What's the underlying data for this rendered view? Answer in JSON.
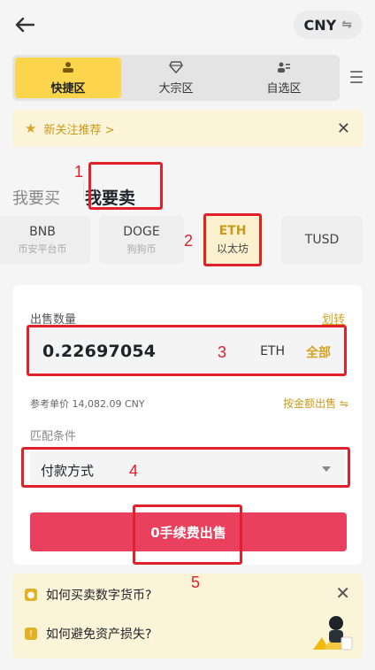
{
  "header": {
    "currency": "CNY",
    "currency_swap_icon": "swap-arrows-icon"
  },
  "zones": [
    {
      "label": "快捷区",
      "icon": "user-group-icon",
      "active": true
    },
    {
      "label": "大宗区",
      "icon": "diamond-icon",
      "active": false
    },
    {
      "label": "自选区",
      "icon": "user-card-icon",
      "active": false
    }
  ],
  "notice": {
    "text": "新关注推荐 >",
    "close": "✕"
  },
  "trade_tabs": {
    "buy": "我要买",
    "sell": "我要卖",
    "active": "sell"
  },
  "coins": [
    {
      "symbol": "BNB",
      "name": "币安平台币"
    },
    {
      "symbol": "DOGE",
      "name": "狗狗币"
    },
    {
      "symbol": "ETH",
      "name": "以太坊",
      "active": true
    },
    {
      "symbol": "TUSD",
      "name": ""
    }
  ],
  "sell_form": {
    "quantity_label": "出售数量",
    "transfer_link": "划转",
    "amount_value": "0.22697054",
    "amount_unit": "ETH",
    "all_button": "全部",
    "ref_price": "参考单价 14,082.09 CNY",
    "by_total": "按金额出售 ⇋",
    "match_label": "匹配条件",
    "payment_method": "付款方式",
    "sell_button": "0手续费出售"
  },
  "help": {
    "items": [
      "如何买卖数字货币?",
      "如何避免资产损失?"
    ],
    "close": "✕"
  },
  "annotations": [
    "1",
    "2",
    "3",
    "4",
    "5"
  ],
  "colors": {
    "accent_yellow": "#fcd54d",
    "sell_red": "#e9405e",
    "annotation_red": "#e0202a"
  }
}
